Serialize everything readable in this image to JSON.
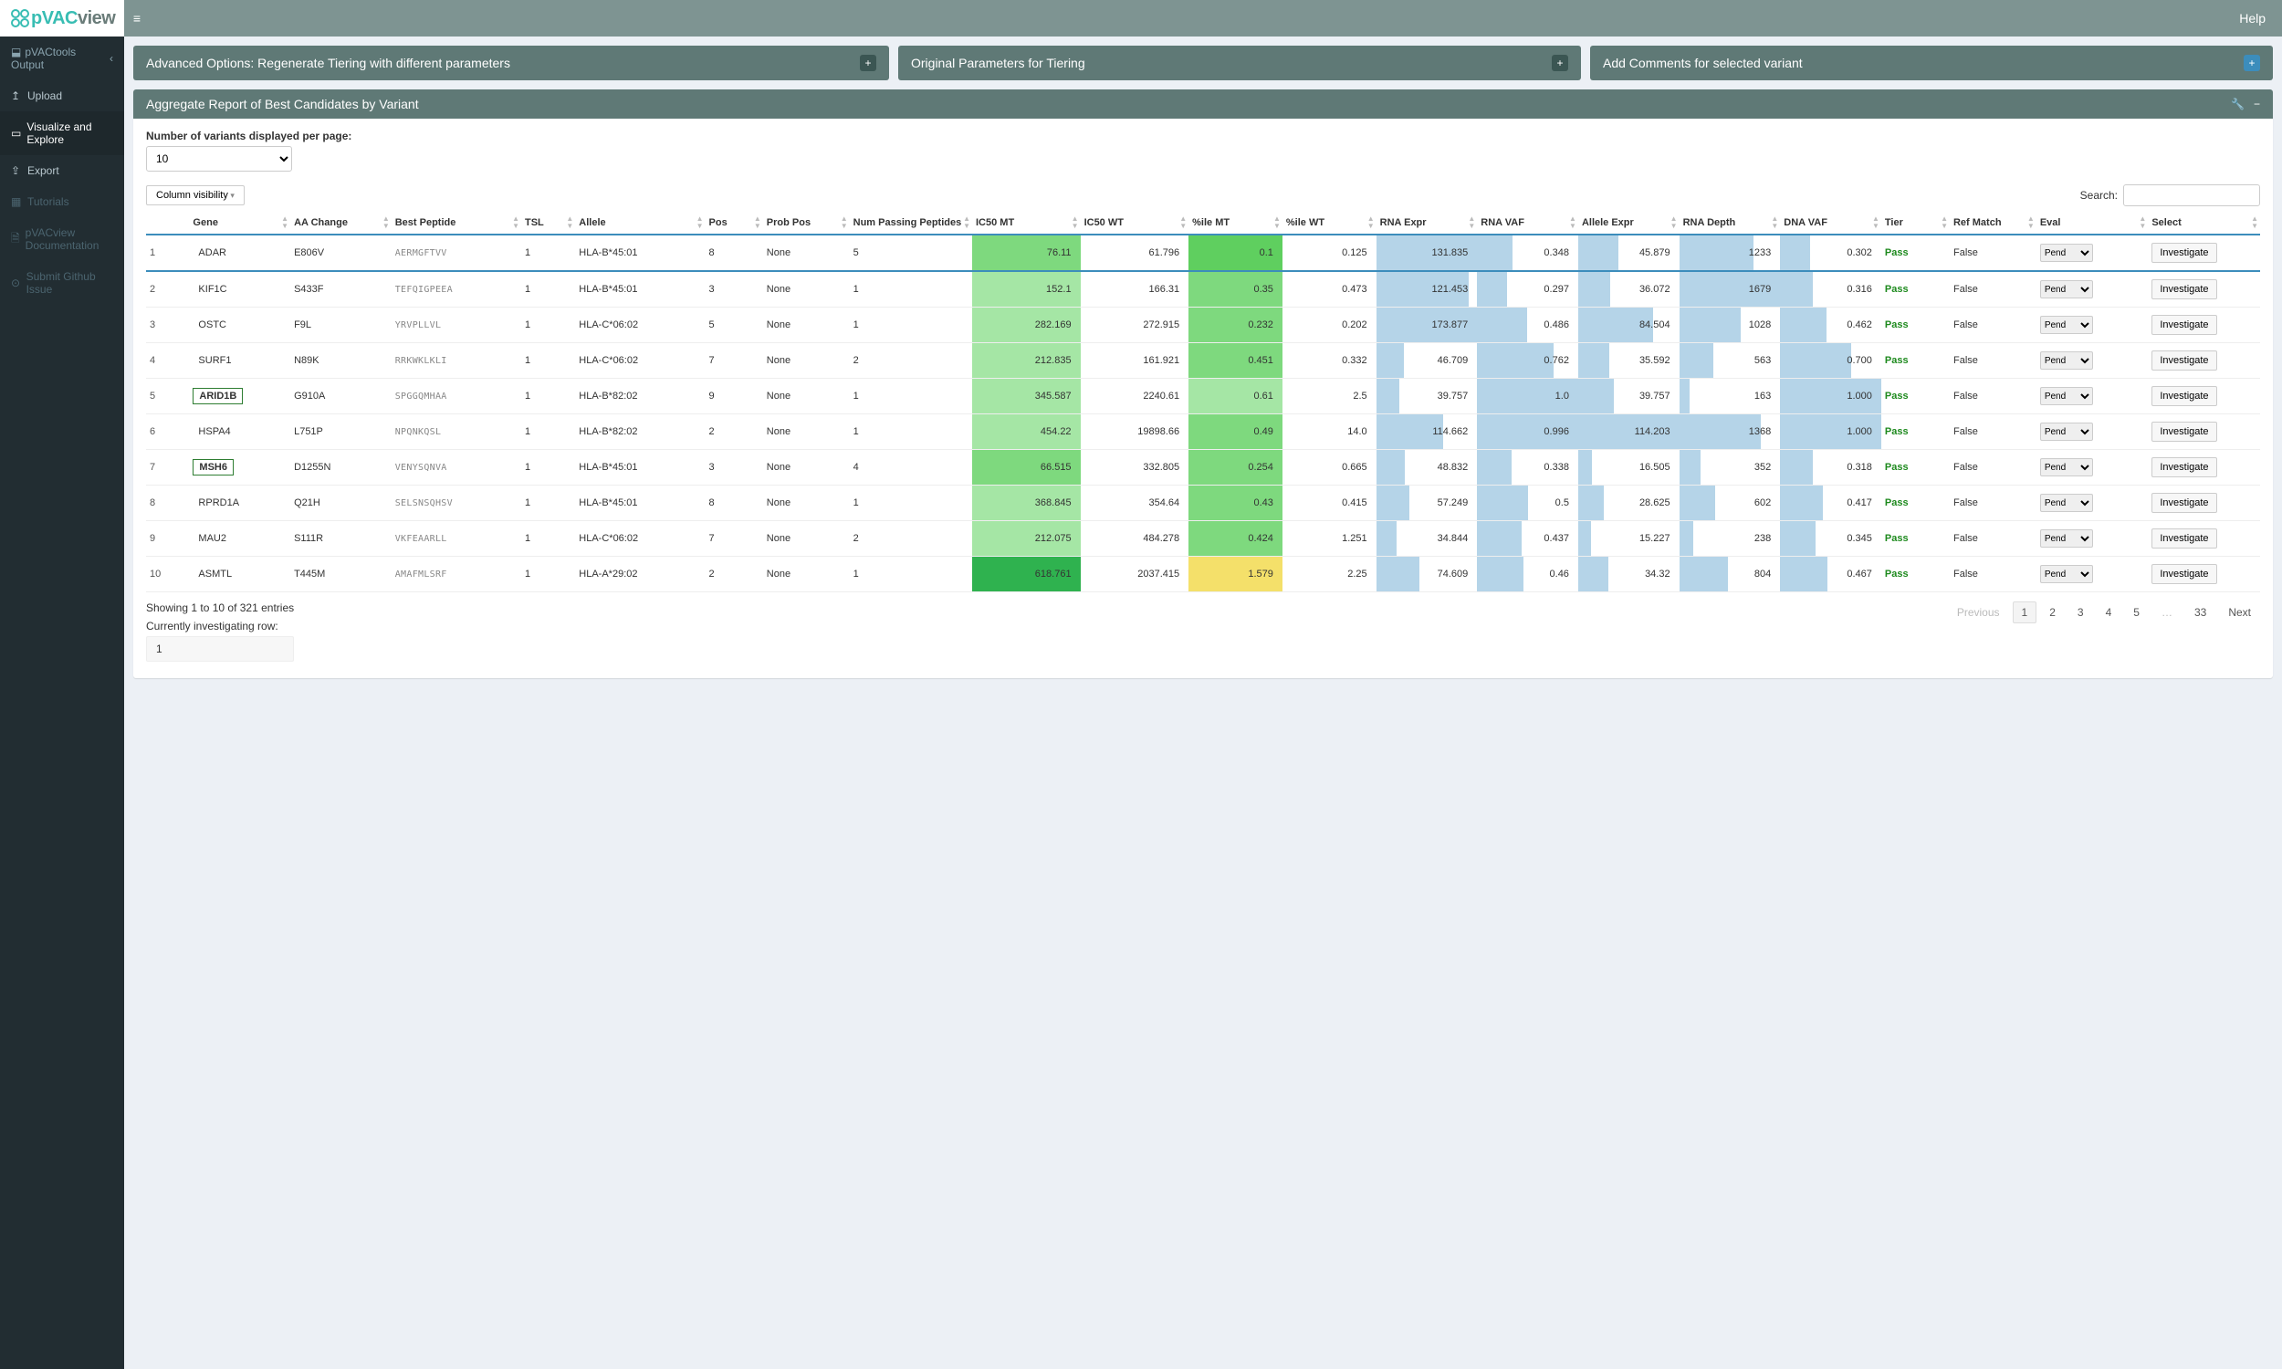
{
  "brand": {
    "p1": "pVAC",
    "p2": "view"
  },
  "topbar": {
    "help": "Help"
  },
  "sidebar": {
    "group": "pVACtools Output",
    "items": [
      {
        "icon": "↥",
        "label": "Upload"
      },
      {
        "icon": "▭",
        "label": "Visualize and Explore",
        "active": true
      },
      {
        "icon": "⇪",
        "label": "Export"
      }
    ],
    "extra": [
      {
        "icon": "▦",
        "label": "Tutorials"
      },
      {
        "icon": "🗎",
        "label": "pVACview Documentation"
      },
      {
        "icon": "⊙",
        "label": "Submit Github Issue"
      }
    ]
  },
  "panels": {
    "a": "Advanced Options: Regenerate Tiering with different parameters",
    "b": "Original Parameters for Tiering",
    "c": "Add Comments for selected variant"
  },
  "report": {
    "title": "Aggregate Report of Best Candidates by Variant",
    "perpage_label": "Number of variants displayed per page:",
    "perpage_value": "10",
    "colvis": "Column visibility",
    "search_label": "Search:",
    "columns": [
      "",
      "Gene",
      "AA Change",
      "Best Peptide",
      "TSL",
      "Allele",
      "Pos",
      "Prob Pos",
      "Num Passing Peptides",
      "IC50 MT",
      "IC50 WT",
      "%ile MT",
      "%ile WT",
      "RNA Expr",
      "RNA VAF",
      "Allele Expr",
      "RNA Depth",
      "DNA VAF",
      "Tier",
      "Ref Match",
      "Eval",
      "Select"
    ],
    "rows": [
      {
        "n": "1",
        "gene": "ADAR",
        "aa": "E806V",
        "pep": "AERMGFTVV",
        "tsl": "1",
        "allele": "HLA-B*45:01",
        "pos": "8",
        "pp": "None",
        "npp": "5",
        "ic50mt": "76.11",
        "ic50wt": "61.796",
        "pmt": "0.1",
        "pwt": "0.125",
        "rexp": "131.835",
        "rvaf": "0.348",
        "aexp": "45.879",
        "rdep": "1233",
        "dvaf": "0.302",
        "tier": "Pass",
        "ref": "False",
        "sel": true,
        "boxed": false,
        "mtcls": "bg-g2",
        "pmcls": "bg-green",
        "rexpw": 100,
        "rvafw": 35,
        "aexpw": 40,
        "rdepw": 74,
        "dvafw": 30
      },
      {
        "n": "2",
        "gene": "KIF1C",
        "aa": "S433F",
        "pep": "TEFQIGPEEA",
        "tsl": "1",
        "allele": "HLA-B*45:01",
        "pos": "3",
        "pp": "None",
        "npp": "1",
        "ic50mt": "152.1",
        "ic50wt": "166.31",
        "pmt": "0.35",
        "pwt": "0.473",
        "rexp": "121.453",
        "rvaf": "0.297",
        "aexp": "36.072",
        "rdep": "1679",
        "dvaf": "0.316",
        "tier": "Pass",
        "ref": "False",
        "boxed": false,
        "mtcls": "bg-g3",
        "pmcls": "bg-g2",
        "rexpw": 92,
        "rvafw": 30,
        "aexpw": 32,
        "rdepw": 100,
        "dvafw": 32
      },
      {
        "n": "3",
        "gene": "OSTC",
        "aa": "F9L",
        "pep": "YRVPLLVL",
        "tsl": "1",
        "allele": "HLA-C*06:02",
        "pos": "5",
        "pp": "None",
        "npp": "1",
        "ic50mt": "282.169",
        "ic50wt": "272.915",
        "pmt": "0.232",
        "pwt": "0.202",
        "rexp": "173.877",
        "rvaf": "0.486",
        "aexp": "84.504",
        "rdep": "1028",
        "dvaf": "0.462",
        "tier": "Pass",
        "ref": "False",
        "boxed": false,
        "mtcls": "bg-g3",
        "pmcls": "bg-g2",
        "rexpw": 100,
        "rvafw": 49,
        "aexpw": 74,
        "rdepw": 61,
        "dvafw": 46
      },
      {
        "n": "4",
        "gene": "SURF1",
        "aa": "N89K",
        "pep": "RRKWKLKLI",
        "tsl": "1",
        "allele": "HLA-C*06:02",
        "pos": "7",
        "pp": "None",
        "npp": "2",
        "ic50mt": "212.835",
        "ic50wt": "161.921",
        "pmt": "0.451",
        "pwt": "0.332",
        "rexp": "46.709",
        "rvaf": "0.762",
        "aexp": "35.592",
        "rdep": "563",
        "dvaf": "0.700",
        "tier": "Pass",
        "ref": "False",
        "boxed": false,
        "mtcls": "bg-g3",
        "pmcls": "bg-g2",
        "rexpw": 27,
        "rvafw": 76,
        "aexpw": 31,
        "rdepw": 34,
        "dvafw": 70
      },
      {
        "n": "5",
        "gene": "ARID1B",
        "aa": "G910A",
        "pep": "SPGGQMHAA",
        "tsl": "1",
        "allele": "HLA-B*82:02",
        "pos": "9",
        "pp": "None",
        "npp": "1",
        "ic50mt": "345.587",
        "ic50wt": "2240.61",
        "pmt": "0.61",
        "pwt": "2.5",
        "rexp": "39.757",
        "rvaf": "1.0",
        "aexp": "39.757",
        "rdep": "163",
        "dvaf": "1.000",
        "tier": "Pass",
        "ref": "False",
        "boxed": true,
        "mtcls": "bg-g3",
        "pmcls": "bg-g3",
        "rexpw": 23,
        "rvafw": 100,
        "aexpw": 35,
        "rdepw": 10,
        "dvafw": 100
      },
      {
        "n": "6",
        "gene": "HSPA4",
        "aa": "L751P",
        "pep": "NPQNKQSL",
        "tsl": "1",
        "allele": "HLA-B*82:02",
        "pos": "2",
        "pp": "None",
        "npp": "1",
        "ic50mt": "454.22",
        "ic50wt": "19898.66",
        "pmt": "0.49",
        "pwt": "14.0",
        "rexp": "114.662",
        "rvaf": "0.996",
        "aexp": "114.203",
        "rdep": "1368",
        "dvaf": "1.000",
        "tier": "Pass",
        "ref": "False",
        "boxed": false,
        "mtcls": "bg-g3",
        "pmcls": "bg-g2",
        "rexpw": 66,
        "rvafw": 100,
        "aexpw": 100,
        "rdepw": 81,
        "dvafw": 100
      },
      {
        "n": "7",
        "gene": "MSH6",
        "aa": "D1255N",
        "pep": "VENYSQNVA",
        "tsl": "1",
        "allele": "HLA-B*45:01",
        "pos": "3",
        "pp": "None",
        "npp": "4",
        "ic50mt": "66.515",
        "ic50wt": "332.805",
        "pmt": "0.254",
        "pwt": "0.665",
        "rexp": "48.832",
        "rvaf": "0.338",
        "aexp": "16.505",
        "rdep": "352",
        "dvaf": "0.318",
        "tier": "Pass",
        "ref": "False",
        "boxed": true,
        "mtcls": "bg-g2",
        "pmcls": "bg-g2",
        "rexpw": 28,
        "rvafw": 34,
        "aexpw": 14,
        "rdepw": 21,
        "dvafw": 32
      },
      {
        "n": "8",
        "gene": "RPRD1A",
        "aa": "Q21H",
        "pep": "SELSNSQHSV",
        "tsl": "1",
        "allele": "HLA-B*45:01",
        "pos": "8",
        "pp": "None",
        "npp": "1",
        "ic50mt": "368.845",
        "ic50wt": "354.64",
        "pmt": "0.43",
        "pwt": "0.415",
        "rexp": "57.249",
        "rvaf": "0.5",
        "aexp": "28.625",
        "rdep": "602",
        "dvaf": "0.417",
        "tier": "Pass",
        "ref": "False",
        "boxed": false,
        "mtcls": "bg-g3",
        "pmcls": "bg-g2",
        "rexpw": 33,
        "rvafw": 50,
        "aexpw": 25,
        "rdepw": 36,
        "dvafw": 42
      },
      {
        "n": "9",
        "gene": "MAU2",
        "aa": "S111R",
        "pep": "VKFEAARLL",
        "tsl": "1",
        "allele": "HLA-C*06:02",
        "pos": "7",
        "pp": "None",
        "npp": "2",
        "ic50mt": "212.075",
        "ic50wt": "484.278",
        "pmt": "0.424",
        "pwt": "1.251",
        "rexp": "34.844",
        "rvaf": "0.437",
        "aexp": "15.227",
        "rdep": "238",
        "dvaf": "0.345",
        "tier": "Pass",
        "ref": "False",
        "boxed": false,
        "mtcls": "bg-g3",
        "pmcls": "bg-g2",
        "rexpw": 20,
        "rvafw": 44,
        "aexpw": 13,
        "rdepw": 14,
        "dvafw": 35
      },
      {
        "n": "10",
        "gene": "ASMTL",
        "aa": "T445M",
        "pep": "AMAFMLSRF",
        "tsl": "1",
        "allele": "HLA-A*29:02",
        "pos": "2",
        "pp": "None",
        "npp": "1",
        "ic50mt": "618.761",
        "ic50wt": "2037.415",
        "pmt": "1.579",
        "pwt": "2.25",
        "rexp": "74.609",
        "rvaf": "0.46",
        "aexp": "34.32",
        "rdep": "804",
        "dvaf": "0.467",
        "tier": "Pass",
        "ref": "False",
        "boxed": false,
        "mtcls": "bg-dgreen",
        "pmcls": "bg-y",
        "rexpw": 43,
        "rvafw": 46,
        "aexpw": 30,
        "rdepw": 48,
        "dvafw": 47
      }
    ],
    "eval_option": "Pend",
    "inv_label": "Investigate",
    "info": "Showing 1 to 10 of 321 entries",
    "curinv_label": "Currently investigating row:",
    "curinv_value": "1",
    "pager": {
      "prev": "Previous",
      "next": "Next",
      "pages": [
        "1",
        "2",
        "3",
        "4",
        "5",
        "…",
        "33"
      ],
      "active": "1"
    }
  }
}
